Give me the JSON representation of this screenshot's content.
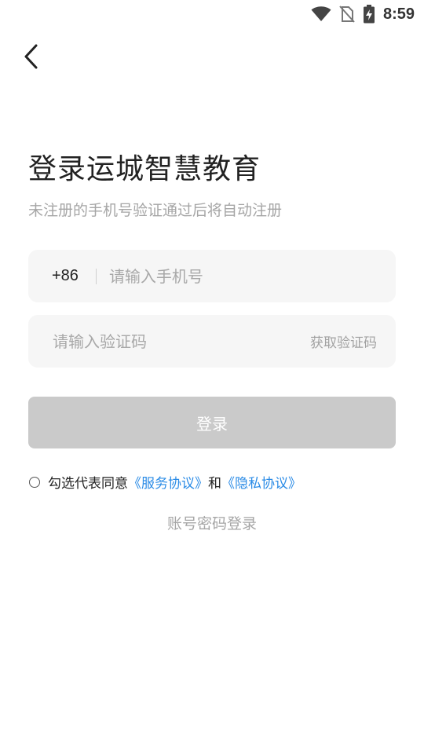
{
  "status_bar": {
    "time": "8:59",
    "icons": [
      "wifi-icon",
      "no-sim-icon",
      "battery-charging-icon"
    ]
  },
  "header": {
    "back_icon": "chevron-left-icon"
  },
  "title": "登录运城智慧教育",
  "subtitle": "未注册的手机号验证通过后将自动注册",
  "phone_field": {
    "country_code": "+86",
    "placeholder": "请输入手机号",
    "value": ""
  },
  "code_field": {
    "placeholder": "请输入验证码",
    "value": "",
    "get_code_label": "获取验证码"
  },
  "login_button": {
    "label": "登录",
    "color": "#cacaca"
  },
  "agreement": {
    "prefix": "勾选代表同意",
    "service_link": "《服务协议》",
    "conjunction": "和",
    "privacy_link": "《隐私协议》",
    "checked": false,
    "link_color": "#2a8be6"
  },
  "account_login_label": "账号密码登录"
}
